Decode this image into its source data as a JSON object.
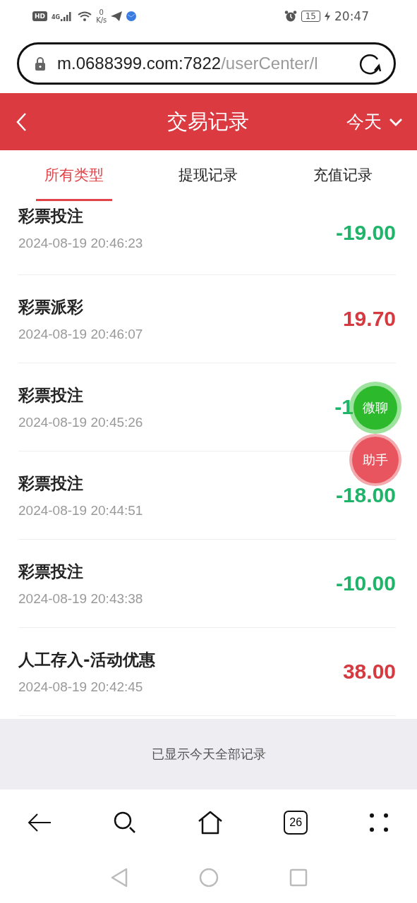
{
  "status_bar": {
    "badge": "HD",
    "network": "4G",
    "speed_value": "0",
    "speed_unit": "K/s",
    "battery": "15",
    "time": "20:47"
  },
  "url_bar": {
    "host": "m.0688399.com:7822",
    "path": "/userCenter/l"
  },
  "header": {
    "title": "交易记录",
    "filter": "今天"
  },
  "tabs": [
    {
      "label": "所有类型",
      "selected": true
    },
    {
      "label": "提现记录",
      "selected": false
    },
    {
      "label": "充值记录",
      "selected": false
    }
  ],
  "records": [
    {
      "title": "彩票投注",
      "time": "2024-08-19 20:46:23",
      "amount": "-19.00",
      "kind": "debit"
    },
    {
      "title": "彩票派彩",
      "time": "2024-08-19 20:46:07",
      "amount": "19.70",
      "kind": "credit"
    },
    {
      "title": "彩票投注",
      "time": "2024-08-19 20:45:26",
      "amount": "-1",
      "kind": "debit",
      "covered": true
    },
    {
      "title": "彩票投注",
      "time": "2024-08-19 20:44:51",
      "amount": "-18.00",
      "kind": "debit"
    },
    {
      "title": "彩票投注",
      "time": "2024-08-19 20:43:38",
      "amount": "-10.00",
      "kind": "debit"
    },
    {
      "title": "人工存入-活动优惠",
      "time": "2024-08-19 20:42:45",
      "amount": "38.00",
      "kind": "credit"
    }
  ],
  "end_note": "已显示今天全部记录",
  "floating_buttons": [
    {
      "label": "微聊",
      "kind": "chat"
    },
    {
      "label": "助手",
      "kind": "helper"
    }
  ],
  "browser_toolbar": {
    "tab_count": "26"
  }
}
